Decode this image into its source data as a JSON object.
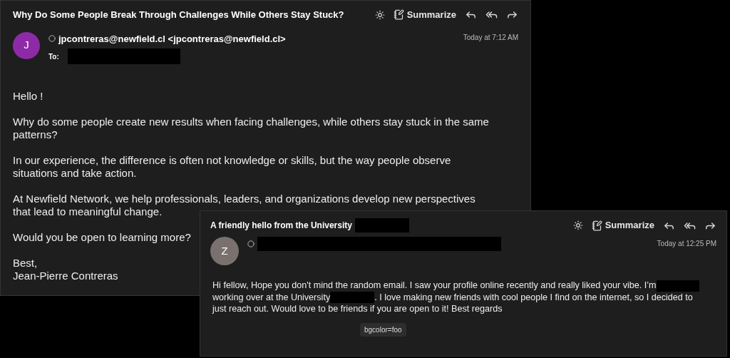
{
  "emails": [
    {
      "subject": [
        {
          "kind": "text",
          "text": "Why Do Some People Break Through Challenges While Others Stay Stuck?"
        }
      ],
      "summarize": "Summarize",
      "avatar": {
        "letter": "J",
        "color": "#8e2aa8"
      },
      "sender": [
        {
          "kind": "text",
          "text": "jpcontreras@newfield.cl <jpcontreras@newfield.cl>"
        }
      ],
      "to_label": "To:",
      "time": "Today at 7:12 AM",
      "paragraphs": [
        [
          {
            "kind": "text",
            "text": "Hello !"
          }
        ],
        [
          {
            "kind": "text",
            "text": "Why do some people create new results when facing challenges, while others stay stuck in the same patterns?"
          }
        ],
        [
          {
            "kind": "text",
            "text": "In our experience, the difference is often not knowledge or skills, but the way people observe situations and take action."
          }
        ],
        [
          {
            "kind": "text",
            "text": "At Newfield Network, we help professionals, leaders, and organizations develop new perspectives that lead to meaningful change."
          }
        ],
        [
          {
            "kind": "text",
            "text": "Would you be open to learning more?"
          }
        ],
        [
          {
            "kind": "text",
            "text": "Best,"
          },
          {
            "kind": "break"
          },
          {
            "kind": "text",
            "text": "Jean-Pierre Contreras"
          }
        ]
      ]
    },
    {
      "subject": [
        {
          "kind": "text",
          "text": "A friendly hello from the University"
        },
        {
          "kind": "redacted"
        }
      ],
      "summarize": "Summarize",
      "avatar": {
        "letter": "Z",
        "color": "#7a716e"
      },
      "sender": [
        {
          "kind": "redacted"
        }
      ],
      "time": "Today at 12:25 PM",
      "paragraphs": [
        [
          {
            "kind": "text",
            "text": "Hi fellow, Hope you don't mind the random email. I saw your profile online recently and really liked your vibe. I’m"
          },
          {
            "kind": "redacted"
          },
          {
            "kind": "break"
          },
          {
            "kind": "text",
            "text": "working over at the University"
          },
          {
            "kind": "redacted"
          },
          {
            "kind": "text",
            "text": ". I love making new friends with cool people I find on the internet, so I decided to"
          },
          {
            "kind": "break"
          },
          {
            "kind": "text",
            "text": "just reach out. Would love to be friends if you are open to it! Best regards"
          }
        ]
      ],
      "tag": "bgcolor=foo"
    }
  ]
}
